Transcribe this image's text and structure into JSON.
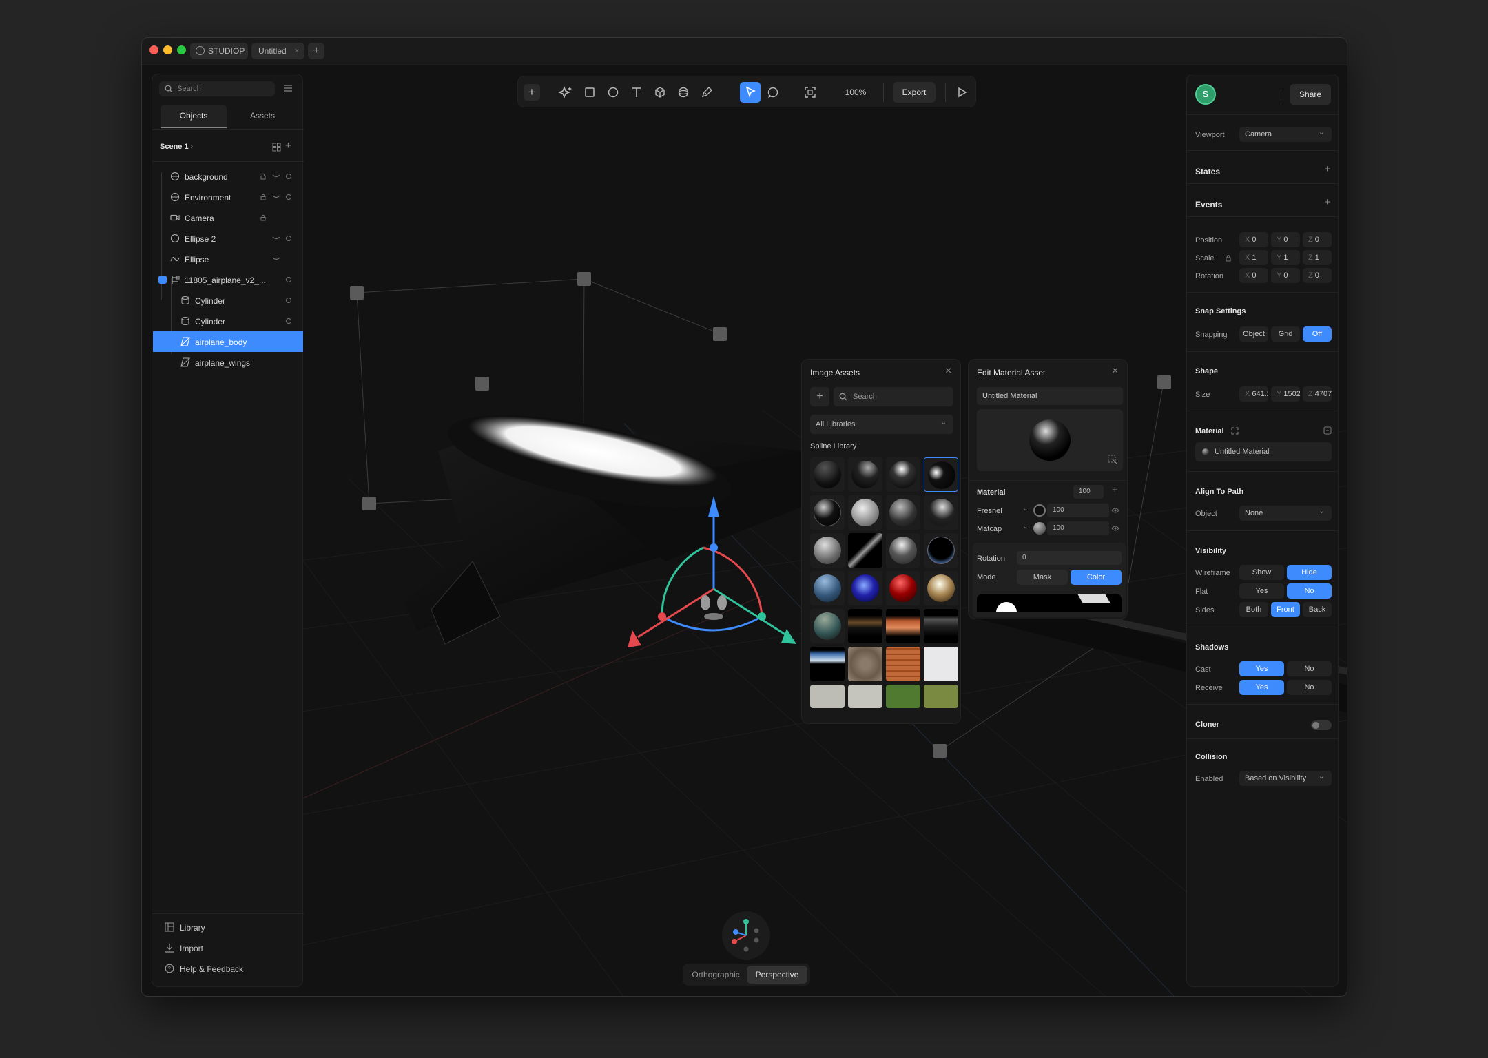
{
  "titlebar": {
    "app_label": "STUDIOP",
    "doc_tab": "Untitled"
  },
  "left": {
    "search_placeholder": "Search",
    "tabs": [
      {
        "label": "Objects"
      },
      {
        "label": "Assets"
      }
    ],
    "scene": "Scene 1",
    "items": [
      {
        "name": "background"
      },
      {
        "name": "Environment"
      },
      {
        "name": "Camera"
      },
      {
        "name": "Ellipse 2"
      },
      {
        "name": "Ellipse"
      },
      {
        "name": "11805_airplane_v2_..."
      },
      {
        "name": "Cylinder"
      },
      {
        "name": "Cylinder"
      },
      {
        "name": "airplane_body"
      },
      {
        "name": "airplane_wings"
      }
    ],
    "footer": [
      {
        "label": "Library"
      },
      {
        "label": "Import"
      },
      {
        "label": "Help & Feedback"
      }
    ]
  },
  "toolbar": {
    "zoom": "100%",
    "export": "Export"
  },
  "view": {
    "ortho": "Orthographic",
    "persp": "Perspective"
  },
  "image_assets": {
    "title": "Image Assets",
    "search_placeholder": "Search",
    "libraries": "All Libraries",
    "section": "Spline Library"
  },
  "edit_material": {
    "title": "Edit Material Asset",
    "name": "Untitled Material",
    "material_label": "Material",
    "material_value": "100",
    "fresnel_label": "Fresnel",
    "fresnel_value": "100",
    "matcap_label": "Matcap",
    "matcap_value": "100",
    "rotation_label": "Rotation",
    "rotation_value": "0",
    "mode_label": "Mode",
    "mode_mask": "Mask",
    "mode_color": "Color"
  },
  "right": {
    "avatar": "S",
    "share": "Share",
    "viewport_label": "Viewport",
    "viewport_value": "Camera",
    "states": "States",
    "events": "Events",
    "position_label": "Position",
    "scale_label": "Scale",
    "rotation_label": "Rotation",
    "pos": {
      "x": "0",
      "y": "0",
      "z": "0"
    },
    "scale": {
      "x": "1",
      "y": "1",
      "z": "1"
    },
    "rot": {
      "x": "0",
      "y": "0",
      "z": "0"
    },
    "axis": {
      "x": "X",
      "y": "Y",
      "z": "Z"
    },
    "snap_title": "Snap Settings",
    "snapping_label": "Snapping",
    "snap_object": "Object",
    "snap_grid": "Grid",
    "snap_off": "Off",
    "shape_title": "Shape",
    "size_label": "Size",
    "size": {
      "x": "641.2",
      "y": "1502",
      "z": "4707"
    },
    "material_title": "Material",
    "material_name": "Untitled Material",
    "align_title": "Align To Path",
    "object_label": "Object",
    "object_value": "None",
    "visibility_title": "Visibility",
    "wireframe_label": "Wireframe",
    "show": "Show",
    "hide": "Hide",
    "flat_label": "Flat",
    "yes": "Yes",
    "no": "No",
    "sides_label": "Sides",
    "both": "Both",
    "front": "Front",
    "back": "Back",
    "shadows_title": "Shadows",
    "cast_label": "Cast",
    "receive_label": "Receive",
    "cloner": "Cloner",
    "collision_title": "Collision",
    "enabled_label": "Enabled",
    "enabled_value": "Based on Visibility"
  },
  "colors": {
    "accent": "#3d8bfd",
    "avatar": "#2e9e6a",
    "axis_x": "#e5484d",
    "axis_y": "#30c29a",
    "axis_z": "#3d8bfd"
  }
}
